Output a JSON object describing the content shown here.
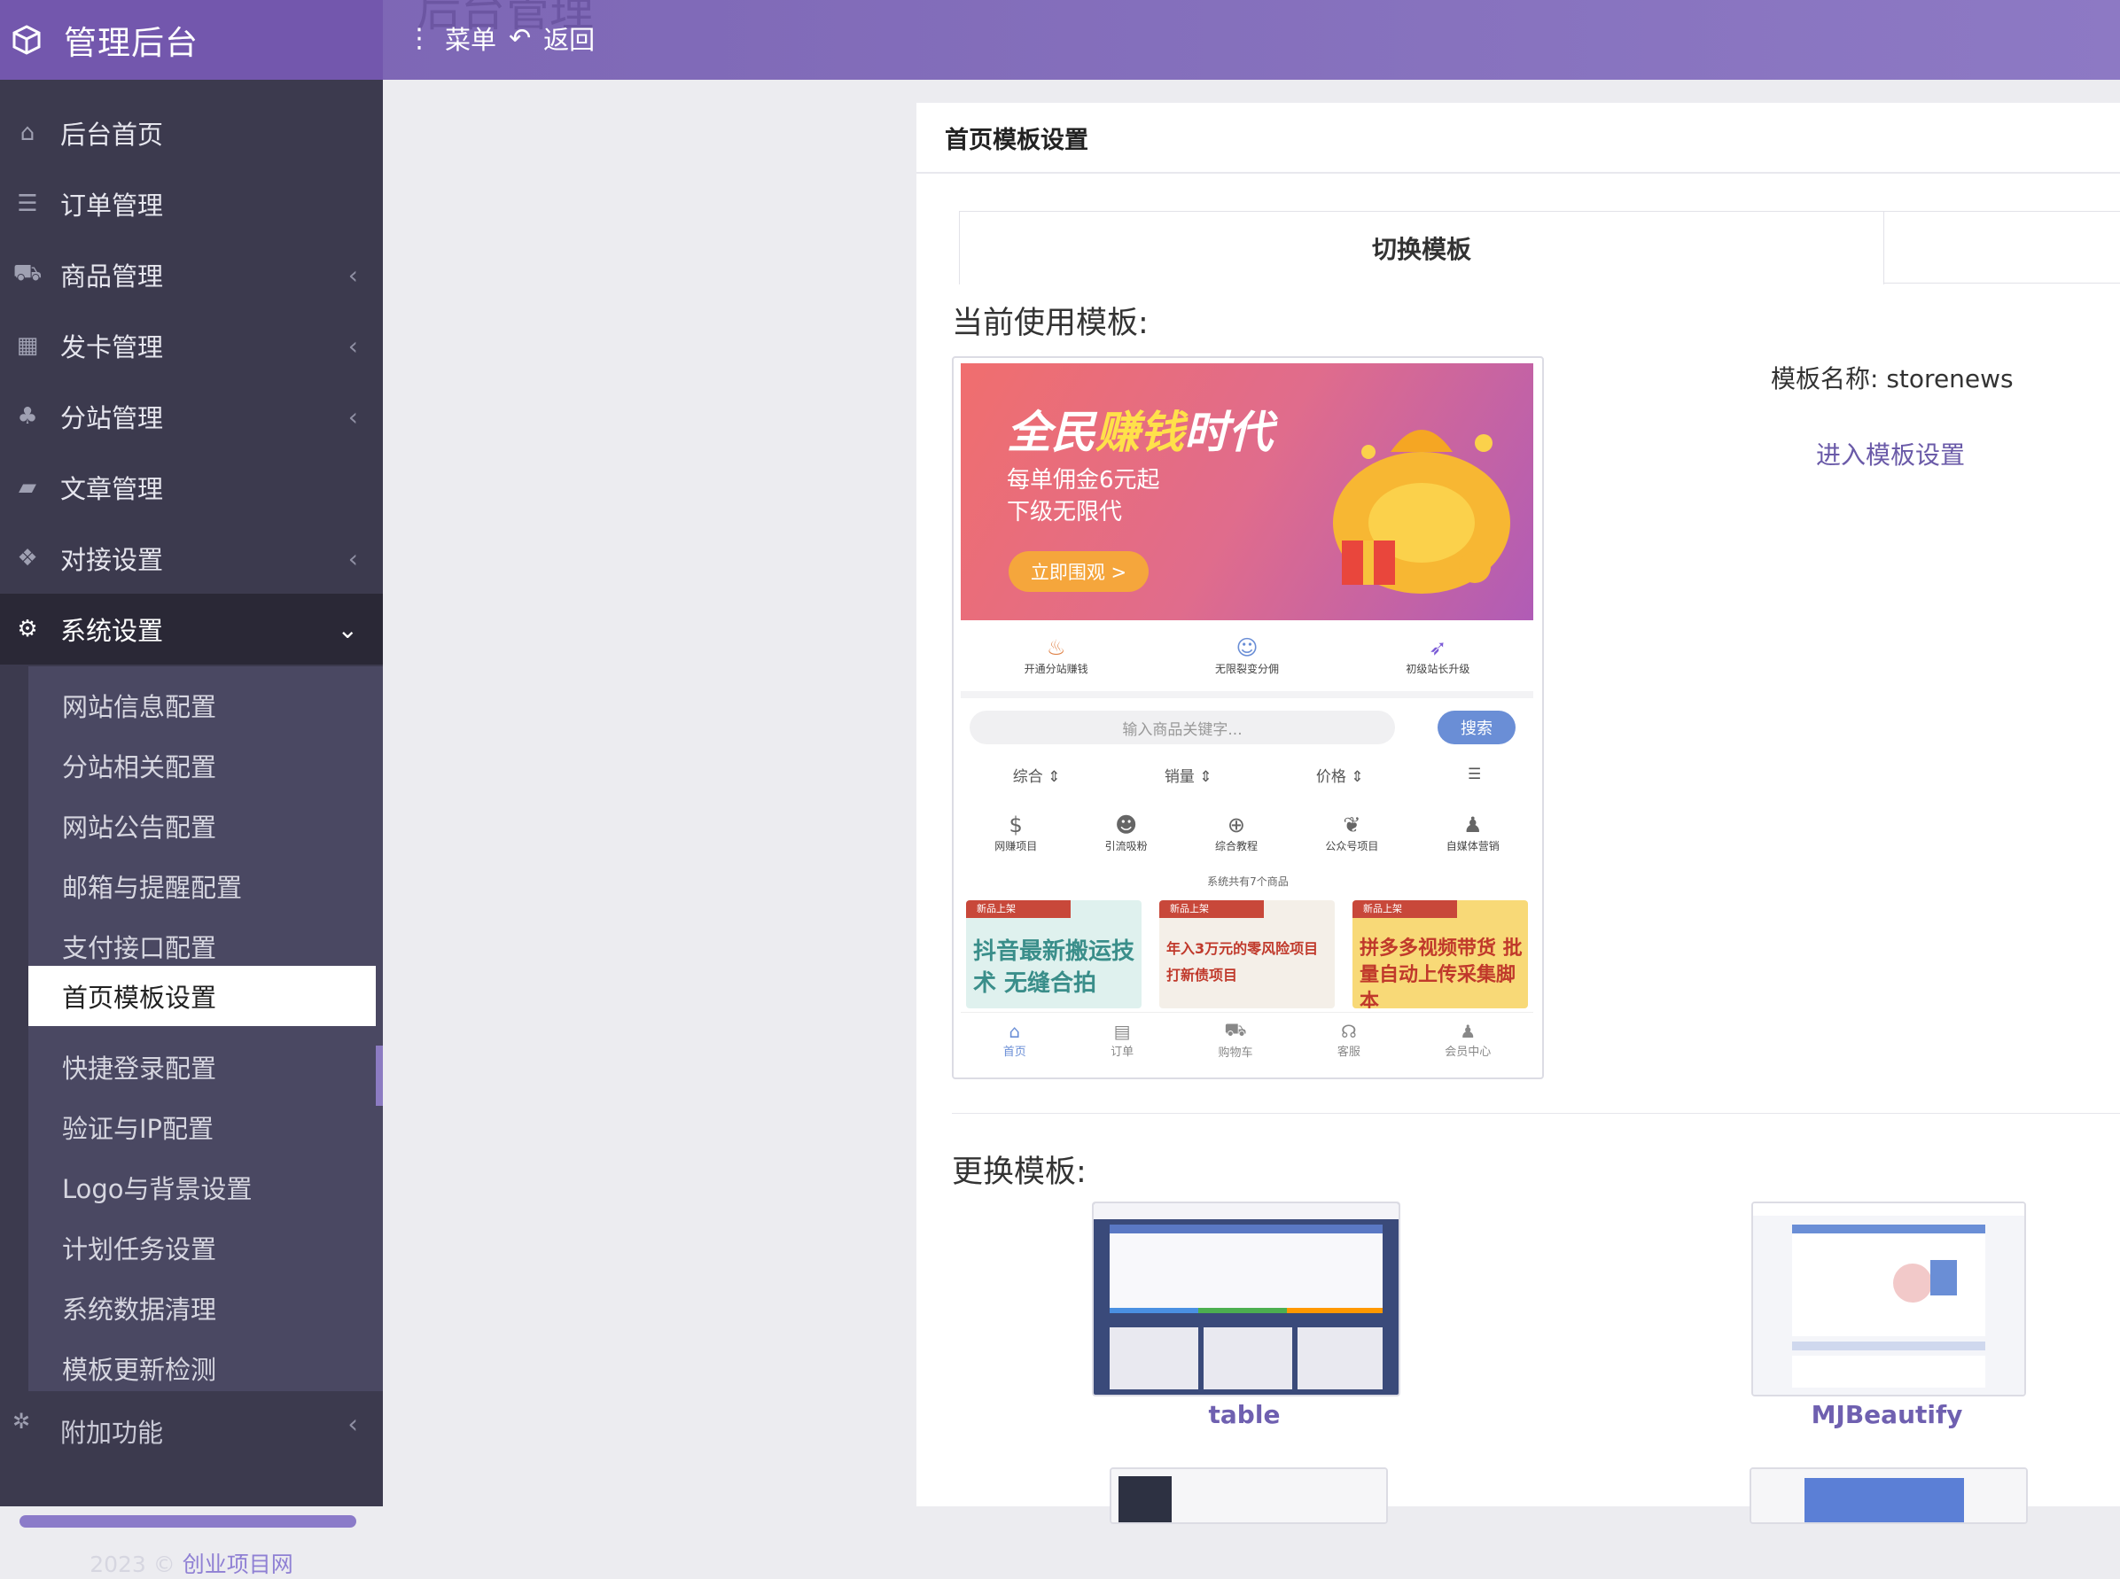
{
  "header": {
    "app_title": "管理后台",
    "ghost_title": "后台管理",
    "menu_label": "菜单",
    "back_label": "返回"
  },
  "sidebar": {
    "items": [
      {
        "label": "后台首页",
        "icon": "home-icon"
      },
      {
        "label": "订单管理",
        "icon": "list-icon"
      },
      {
        "label": "商品管理",
        "icon": "cart-icon"
      },
      {
        "label": "发卡管理",
        "icon": "grid-icon"
      },
      {
        "label": "分站管理",
        "icon": "sitemap-icon"
      },
      {
        "label": "文章管理",
        "icon": "book-icon"
      },
      {
        "label": "对接设置",
        "icon": "cubes-icon"
      },
      {
        "label": "系统设置",
        "icon": "gear-icon"
      }
    ],
    "sub_items": [
      "网站信息配置",
      "分站相关配置",
      "网站公告配置",
      "邮箱与提醒配置",
      "支付接口配置",
      "首页模板设置",
      "快捷登录配置",
      "验证与IP配置",
      "Logo与背景设置",
      "计划任务设置",
      "系统数据清理",
      "模板更新检测"
    ],
    "extra_item": "附加功能",
    "footer_year": "2023 ©",
    "footer_link": "创业项目网"
  },
  "main": {
    "panel_title": "首页模板设置",
    "switch_tab": "切换模板",
    "current_title": "当前使用模板:",
    "template_name_label": "模板名称:",
    "template_name_value": "storenews",
    "template_settings_link": "进入模板设置",
    "change_title": "更换模板:",
    "templates": [
      {
        "name": "table"
      },
      {
        "name": "MJBeautify"
      }
    ]
  },
  "preview": {
    "banner_title_a": "全民",
    "banner_title_b": "赚钱",
    "banner_title_c": "时代",
    "banner_line1": "每单佣金6元起",
    "banner_line2": "下级无限代",
    "banner_cta": "立即围观 >",
    "features": [
      "开通分站赚钱",
      "无限裂变分佣",
      "初级站长升级"
    ],
    "search_placeholder": "输入商品关键字...",
    "search_button": "搜索",
    "sorts": [
      "综合 ⇕",
      "销量 ⇕",
      "价格 ⇕",
      "☰"
    ],
    "categories": [
      "网赚项目",
      "引流吸粉",
      "综合教程",
      "公众号项目",
      "自媒体营销"
    ],
    "goods_count": "系统共有7个商品",
    "goods_tag": "新品上架",
    "goods": [
      "抖音最新搬运技术 无缝合拍",
      "年入3万元的零风险项目 打新债项目",
      "拼多多视频带货 批量自动上传采集脚本"
    ],
    "tabbar": [
      "首页",
      "订单",
      "购物车",
      "客服",
      "会员中心"
    ]
  },
  "colors": {
    "header": "#7a63b2",
    "sidebar": "#3c3a4e",
    "accent": "#6f60b0"
  }
}
